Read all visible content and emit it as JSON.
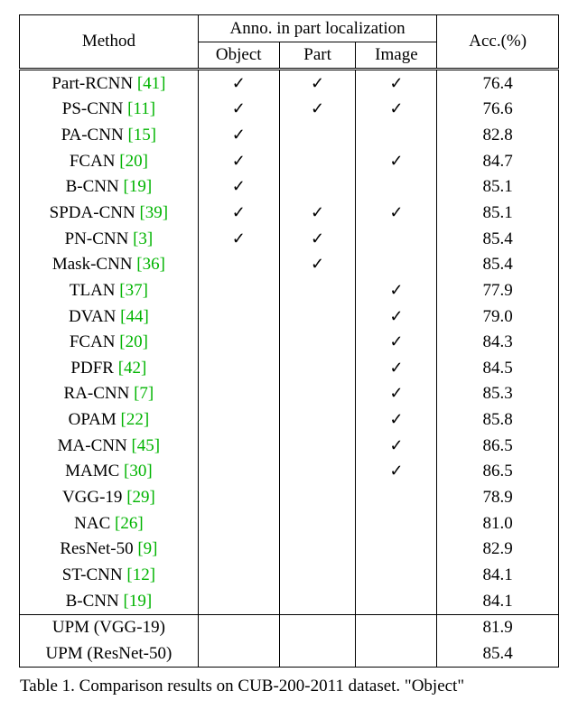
{
  "chart_data": {
    "type": "table",
    "title": "Comparison results on CUB-200-2011 dataset",
    "columns": [
      "Method",
      "Object",
      "Part",
      "Image",
      "Acc.(%)"
    ],
    "header_group": "Anno. in part localization",
    "series": [
      {
        "name": "Part-RCNN [41]",
        "values": [
          true,
          true,
          true,
          76.4
        ]
      },
      {
        "name": "PS-CNN [11]",
        "values": [
          true,
          true,
          true,
          76.6
        ]
      },
      {
        "name": "PA-CNN [15]",
        "values": [
          true,
          false,
          false,
          82.8
        ]
      },
      {
        "name": "FCAN [20]",
        "values": [
          true,
          false,
          true,
          84.7
        ]
      },
      {
        "name": "B-CNN [19]",
        "values": [
          true,
          false,
          false,
          85.1
        ]
      },
      {
        "name": "SPDA-CNN [39]",
        "values": [
          true,
          true,
          true,
          85.1
        ]
      },
      {
        "name": "PN-CNN [3]",
        "values": [
          true,
          true,
          false,
          85.4
        ]
      },
      {
        "name": "Mask-CNN [36]",
        "values": [
          false,
          true,
          false,
          85.4
        ]
      },
      {
        "name": "TLAN [37]",
        "values": [
          false,
          false,
          true,
          77.9
        ]
      },
      {
        "name": "DVAN [44]",
        "values": [
          false,
          false,
          true,
          79.0
        ]
      },
      {
        "name": "FCAN [20]",
        "values": [
          false,
          false,
          true,
          84.3
        ]
      },
      {
        "name": "PDFR [42]",
        "values": [
          false,
          false,
          true,
          84.5
        ]
      },
      {
        "name": "RA-CNN [7]",
        "values": [
          false,
          false,
          true,
          85.3
        ]
      },
      {
        "name": "OPAM [22]",
        "values": [
          false,
          false,
          true,
          85.8
        ]
      },
      {
        "name": "MA-CNN [45]",
        "values": [
          false,
          false,
          true,
          86.5
        ]
      },
      {
        "name": "MAMC [30]",
        "values": [
          false,
          false,
          true,
          86.5
        ]
      },
      {
        "name": "VGG-19 [29]",
        "values": [
          false,
          false,
          false,
          78.9
        ]
      },
      {
        "name": "NAC [26]",
        "values": [
          false,
          false,
          false,
          81.0
        ]
      },
      {
        "name": "ResNet-50 [9]",
        "values": [
          false,
          false,
          false,
          82.9
        ]
      },
      {
        "name": "ST-CNN [12]",
        "values": [
          false,
          false,
          false,
          84.1
        ]
      },
      {
        "name": "B-CNN [19]",
        "values": [
          false,
          false,
          false,
          84.1
        ]
      },
      {
        "name": "UPM (VGG-19)",
        "values": [
          false,
          false,
          false,
          81.9
        ],
        "bold_acc": true
      },
      {
        "name": "UPM (ResNet-50)",
        "values": [
          false,
          false,
          false,
          85.4
        ],
        "bold_acc": true
      }
    ]
  },
  "header": {
    "method": "Method",
    "group": "Anno. in part localization",
    "object": "Object",
    "part": "Part",
    "image": "Image",
    "acc": "Acc.(%)"
  },
  "rows": [
    {
      "method": "Part-RCNN ",
      "ref": "[41]",
      "obj": true,
      "part": true,
      "img": true,
      "acc": "76.4"
    },
    {
      "method": "PS-CNN ",
      "ref": "[11]",
      "obj": true,
      "part": true,
      "img": true,
      "acc": "76.6"
    },
    {
      "method": "PA-CNN ",
      "ref": "[15]",
      "obj": true,
      "part": false,
      "img": false,
      "acc": "82.8"
    },
    {
      "method": "FCAN ",
      "ref": "[20]",
      "obj": true,
      "part": false,
      "img": true,
      "acc": "84.7"
    },
    {
      "method": "B-CNN ",
      "ref": "[19]",
      "obj": true,
      "part": false,
      "img": false,
      "acc": "85.1"
    },
    {
      "method": "SPDA-CNN ",
      "ref": "[39]",
      "obj": true,
      "part": true,
      "img": true,
      "acc": "85.1"
    },
    {
      "method": "PN-CNN ",
      "ref": "[3]",
      "obj": true,
      "part": true,
      "img": false,
      "acc": "85.4"
    },
    {
      "method": "Mask-CNN ",
      "ref": "[36]",
      "obj": false,
      "part": true,
      "img": false,
      "acc": "85.4"
    },
    {
      "method": "TLAN ",
      "ref": "[37]",
      "obj": false,
      "part": false,
      "img": true,
      "acc": "77.9"
    },
    {
      "method": "DVAN ",
      "ref": "[44]",
      "obj": false,
      "part": false,
      "img": true,
      "acc": "79.0"
    },
    {
      "method": "FCAN ",
      "ref": "[20]",
      "obj": false,
      "part": false,
      "img": true,
      "acc": "84.3"
    },
    {
      "method": "PDFR ",
      "ref": "[42]",
      "obj": false,
      "part": false,
      "img": true,
      "acc": "84.5"
    },
    {
      "method": "RA-CNN ",
      "ref": "[7]",
      "obj": false,
      "part": false,
      "img": true,
      "acc": "85.3"
    },
    {
      "method": "OPAM ",
      "ref": "[22]",
      "obj": false,
      "part": false,
      "img": true,
      "acc": "85.8"
    },
    {
      "method": "MA-CNN ",
      "ref": "[45]",
      "obj": false,
      "part": false,
      "img": true,
      "acc": "86.5"
    },
    {
      "method": "MAMC ",
      "ref": "[30]",
      "obj": false,
      "part": false,
      "img": true,
      "acc": "86.5"
    },
    {
      "method": "VGG-19 ",
      "ref": "[29]",
      "obj": false,
      "part": false,
      "img": false,
      "acc": "78.9"
    },
    {
      "method": "NAC ",
      "ref": "[26]",
      "obj": false,
      "part": false,
      "img": false,
      "acc": "81.0"
    },
    {
      "method": "ResNet-50 ",
      "ref": "[9]",
      "obj": false,
      "part": false,
      "img": false,
      "acc": "82.9"
    },
    {
      "method": "ST-CNN ",
      "ref": "[12]",
      "obj": false,
      "part": false,
      "img": false,
      "acc": "84.1"
    },
    {
      "method": "B-CNN ",
      "ref": "[19]",
      "obj": false,
      "part": false,
      "img": false,
      "acc": "84.1"
    }
  ],
  "ours": [
    {
      "method": "UPM (VGG-19)",
      "acc": "81.9"
    },
    {
      "method": "UPM (ResNet-50)",
      "acc": "85.4"
    }
  ],
  "caption_prefix": "Table 1. Comparison results on CUB-200-2011 dataset. \"Object\""
}
